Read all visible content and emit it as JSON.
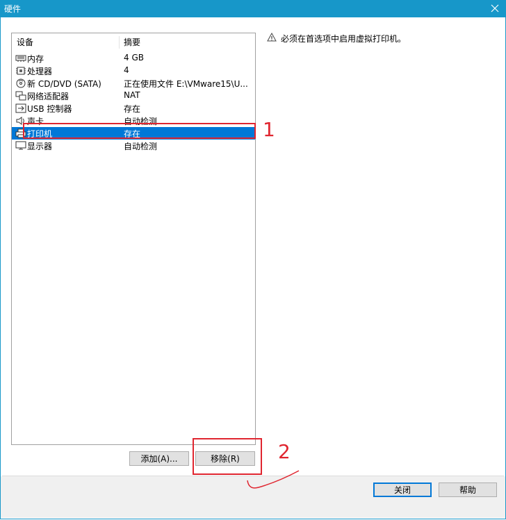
{
  "window": {
    "title": "硬件",
    "close_glyph": "✕"
  },
  "device_list": {
    "header_device": "设备",
    "header_summary": "摘要",
    "rows": [
      {
        "name": "内存",
        "summary": "4 GB",
        "icon": "memory-icon"
      },
      {
        "name": "处理器",
        "summary": "4",
        "icon": "processor-icon"
      },
      {
        "name": "新 CD/DVD (SATA)",
        "summary": "正在使用文件 E:\\VMware15\\U...",
        "icon": "cd-dvd-icon"
      },
      {
        "name": "网络适配器",
        "summary": "NAT",
        "icon": "network-adapter-icon"
      },
      {
        "name": "USB 控制器",
        "summary": "存在",
        "icon": "usb-icon"
      },
      {
        "name": "声卡",
        "summary": "自动检测",
        "icon": "sound-card-icon"
      },
      {
        "name": "打印机",
        "summary": "存在",
        "icon": "printer-icon",
        "selected": true
      },
      {
        "name": "显示器",
        "summary": "自动检测",
        "icon": "display-icon"
      }
    ]
  },
  "info": {
    "icon": "warning-icon",
    "message": "必须在首选项中启用虚拟打印机。"
  },
  "buttons": {
    "add": "添加(A)...",
    "remove": "移除(R)",
    "close": "关闭",
    "help": "帮助"
  },
  "annotations": {
    "label_1": "1",
    "label_2": "2"
  },
  "colors": {
    "titlebar": "#1797c9",
    "selection": "#0078d7",
    "annotation": "#e0252f"
  }
}
